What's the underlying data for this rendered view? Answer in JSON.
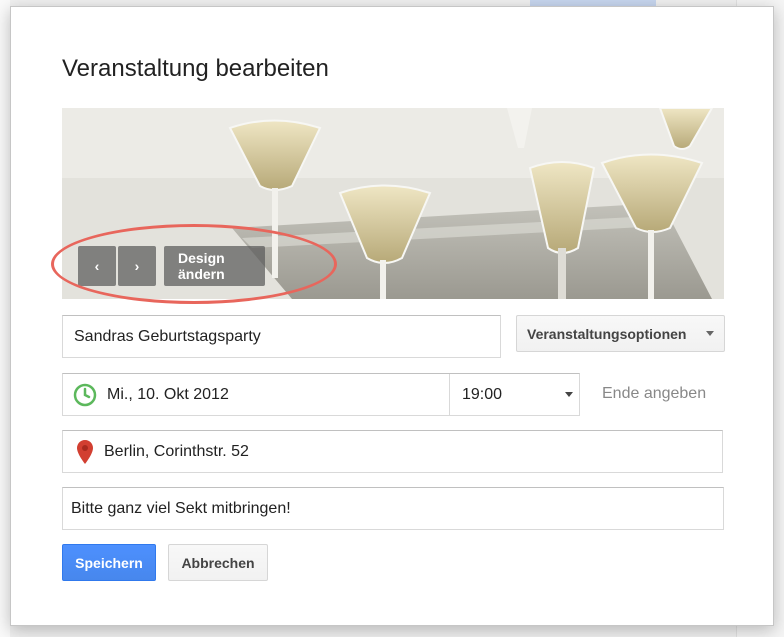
{
  "dialog": {
    "title": "Veranstaltung bearbeiten"
  },
  "banner": {
    "prev_icon": "chevron-left-icon",
    "next_icon": "chevron-right-icon",
    "prev_label": "‹",
    "next_label": "›",
    "design_label": "Design ändern",
    "image_subject": "champagne-glasses-photo"
  },
  "event": {
    "name_value": "Sandras Geburtstagsparty",
    "options_label": "Veranstaltungsoptionen",
    "date_value": "Mi., 10. Okt 2012",
    "time_value": "19:00",
    "end_label": "Ende angeben",
    "location_value": "Berlin, Corinthstr. 52",
    "description_value": "Bitte ganz viel Sekt mitbringen!"
  },
  "actions": {
    "save_label": "Speichern",
    "cancel_label": "Abbrechen"
  },
  "colors": {
    "primary_button": "#4d90fe",
    "clock_icon": "#5cb85c",
    "pin_icon": "#d23f31",
    "annotation": "#e8665c"
  }
}
